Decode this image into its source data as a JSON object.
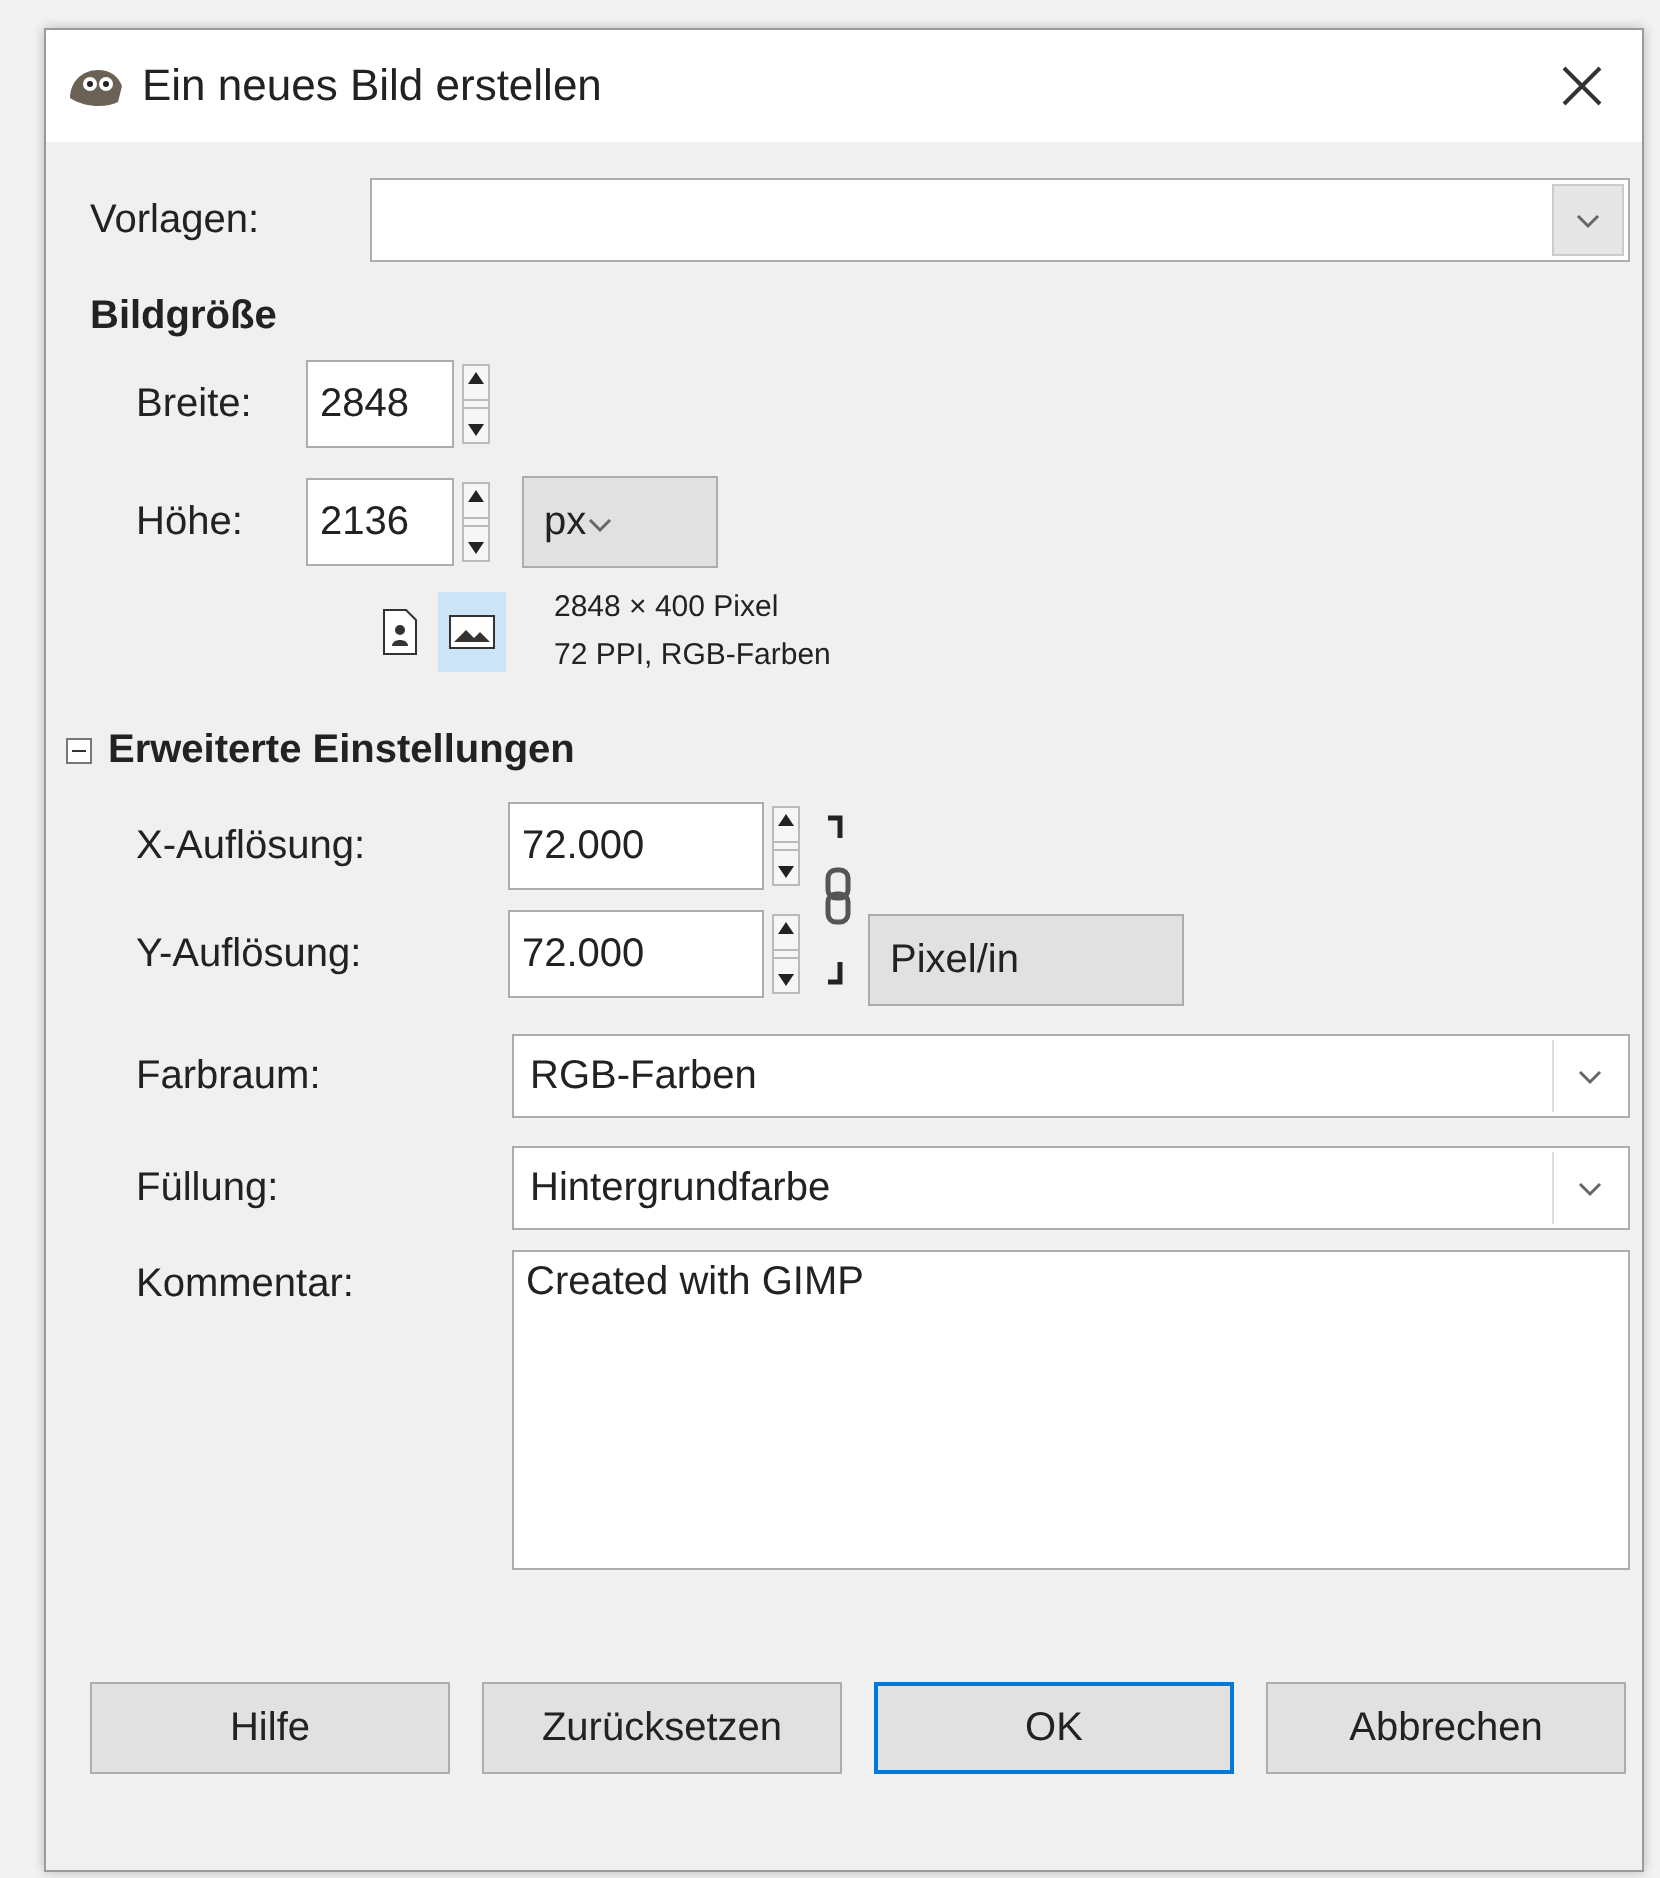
{
  "window": {
    "title": "Ein neues Bild erstellen"
  },
  "template": {
    "label": "Vorlagen:"
  },
  "image_size": {
    "heading": "Bildgröße",
    "width": {
      "label": "Breite:",
      "value": "2848"
    },
    "height": {
      "label": "Höhe:",
      "value": "2136"
    },
    "unit": "px",
    "orientation": [
      {
        "kind": "portrait",
        "selected": false
      },
      {
        "kind": "landscape",
        "selected": true
      }
    ],
    "info": [
      "2848 × 400 Pixel",
      "72 PPI, RGB-Farben"
    ]
  },
  "advanced": {
    "heading": "Erweiterte Einstellungen",
    "expanded": true,
    "x_resolution": {
      "label": "X-Auflösung:",
      "value": "72.000"
    },
    "y_resolution": {
      "label": "Y-Auflösung:",
      "value": "72.000"
    },
    "chained": true,
    "resolution_unit": "Pixel/in",
    "color_space": {
      "label": "Farbraum:",
      "value": "RGB-Farben"
    },
    "fill": {
      "label": "Füllung:",
      "value": "Hintergrundfarbe"
    },
    "comment": {
      "label": "Kommentar:",
      "value": "Created with GIMP"
    }
  },
  "buttons": [
    {
      "label": "Hilfe",
      "selected": false
    },
    {
      "label": "Zurücksetzen",
      "selected": false
    },
    {
      "label": "OK",
      "selected": true
    },
    {
      "label": "Abbrechen",
      "selected": false
    }
  ]
}
